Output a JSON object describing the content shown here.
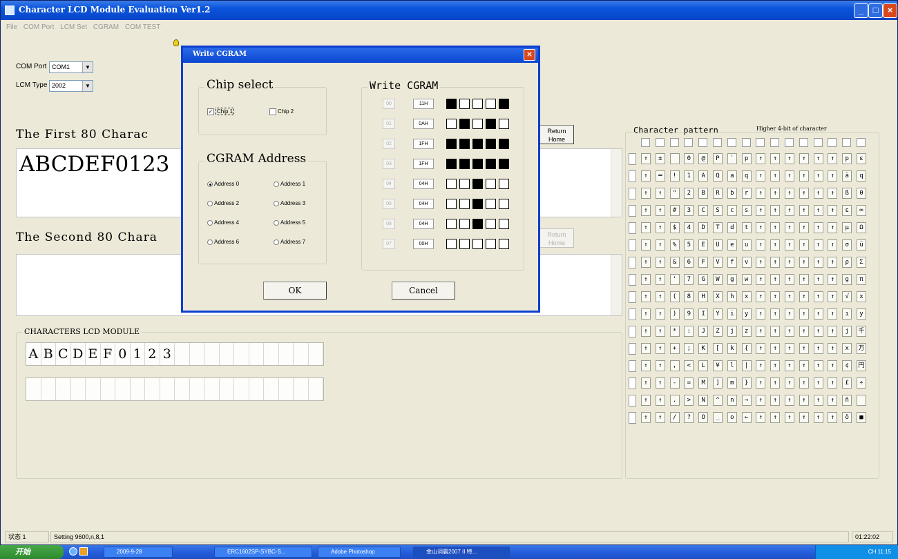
{
  "window": {
    "title": "Character LCD Module Evaluation Ver1.2"
  },
  "menu": [
    "File",
    "COM Port",
    "LCM Set",
    "CGRAM",
    "COM TEST"
  ],
  "settings": {
    "com_port_label": "COM Port",
    "com_port_value": "COM1",
    "lcm_type_label": "LCM Type",
    "lcm_type_value": "2002"
  },
  "first": {
    "heading": "The First 80 Charac",
    "text": "ABCDEF0123",
    "return_button": "Return Home"
  },
  "second": {
    "heading": "The Second 80 Chara",
    "return_button": "Return Home"
  },
  "lcd": {
    "title": "CHARACTERS LCD MODULE",
    "row1": [
      "A",
      "B",
      "C",
      "D",
      "E",
      "F",
      "0",
      "1",
      "2",
      "3",
      "",
      "",
      "",
      "",
      "",
      "",
      "",
      "",
      "",
      ""
    ],
    "row2": [
      "",
      "",
      "",
      "",
      "",
      "",
      "",
      "",
      "",
      "",
      "",
      "",
      "",
      "",
      "",
      "",
      "",
      "",
      "",
      ""
    ]
  },
  "pattern": {
    "title": "Character pattern",
    "subtitle": "Higher 4-bit of character",
    "rows": [
      [
        "↑",
        "±",
        " ",
        "0",
        "@",
        "P",
        "`",
        "p",
        "↑",
        "↑",
        "↑",
        "↑",
        "↑",
        "↑",
        "р",
        "ε"
      ],
      [
        "↑",
        "═",
        "!",
        "1",
        "A",
        "Q",
        "a",
        "q",
        "↑",
        "↑",
        "↑",
        "↑",
        "↑",
        "↑",
        "ä",
        "q"
      ],
      [
        "↑",
        "↑",
        "\"",
        "2",
        "B",
        "R",
        "b",
        "r",
        "↑",
        "↑",
        "↑",
        "↑",
        "↑",
        "↑",
        "ß",
        "θ"
      ],
      [
        "↑",
        "↑",
        "#",
        "3",
        "C",
        "S",
        "c",
        "s",
        "↑",
        "↑",
        "↑",
        "↑",
        "↑",
        "↑",
        "ε",
        "∞"
      ],
      [
        "↑",
        "↑",
        "$",
        "4",
        "D",
        "T",
        "d",
        "t",
        "↑",
        "↑",
        "↑",
        "↑",
        "↑",
        "↑",
        "μ",
        "Ω"
      ],
      [
        "↑",
        "↑",
        "%",
        "5",
        "E",
        "U",
        "e",
        "u",
        "↑",
        "↑",
        "↑",
        "↑",
        "↑",
        "↑",
        "σ",
        "ü"
      ],
      [
        "↑",
        "↑",
        "&",
        "6",
        "F",
        "V",
        "f",
        "v",
        "↑",
        "↑",
        "↑",
        "↑",
        "↑",
        "↑",
        "ρ",
        "Σ"
      ],
      [
        "↑",
        "↑",
        "'",
        "7",
        "G",
        "W",
        "g",
        "w",
        "↑",
        "↑",
        "↑",
        "↑",
        "↑",
        "↑",
        "g",
        "π"
      ],
      [
        "↑",
        "↑",
        "(",
        "8",
        "H",
        "X",
        "h",
        "x",
        "↑",
        "↑",
        "↑",
        "↑",
        "↑",
        "↑",
        "√",
        "x"
      ],
      [
        "↑",
        "↑",
        ")",
        "9",
        "I",
        "Y",
        "i",
        "y",
        "↑",
        "↑",
        "↑",
        "↑",
        "↑",
        "↑",
        "ı",
        "y"
      ],
      [
        "↑",
        "↑",
        "*",
        ":",
        "J",
        "Z",
        "j",
        "z",
        "↑",
        "↑",
        "↑",
        "↑",
        "↑",
        "↑",
        "j",
        "千"
      ],
      [
        "↑",
        "↑",
        "+",
        ";",
        "K",
        "[",
        "k",
        "{",
        "↑",
        "↑",
        "↑",
        "↑",
        "↑",
        "↑",
        "x",
        "万"
      ],
      [
        "↑",
        "↑",
        ",",
        "<",
        "L",
        "¥",
        "l",
        "|",
        "↑",
        "↑",
        "↑",
        "↑",
        "↑",
        "↑",
        "¢",
        "円"
      ],
      [
        "↑",
        "↑",
        "-",
        "=",
        "M",
        "]",
        "m",
        "}",
        "↑",
        "↑",
        "↑",
        "↑",
        "↑",
        "↑",
        "£",
        "÷"
      ],
      [
        "↑",
        "↑",
        ".",
        ">",
        "N",
        "^",
        "n",
        "→",
        "↑",
        "↑",
        "↑",
        "↑",
        "↑",
        "↑",
        "ñ",
        " "
      ],
      [
        "↑",
        "↑",
        "/",
        "?",
        "O",
        "_",
        "o",
        "←",
        "↑",
        "↑",
        "↑",
        "↑",
        "↑",
        "↑",
        "ö",
        "■"
      ]
    ]
  },
  "status": {
    "left": "状态 1",
    "setting": "Setting   9600,n,8,1",
    "time": "01:22:02"
  },
  "taskbar": {
    "start": "开始",
    "tasks": [
      "2009-9-28",
      "ERC1602SP-SYBC-S...",
      "Adobe Photoshop",
      "金山词霸2007 II 特..."
    ],
    "clock": "CH 11:15"
  },
  "dialog": {
    "title": "Write CGRAM",
    "chip_select_title": "Chip select",
    "chip1": "Chip 1",
    "chip2": "Chip 2",
    "cgram_address_title": "CGRAM Address",
    "addresses": [
      "Address 0",
      "Address 1",
      "Address 2",
      "Address 3",
      "Address 4",
      "Address 5",
      "Address 6",
      "Address 7"
    ],
    "write_title": "Write CGRAM",
    "rows": [
      {
        "addr": "00",
        "hex": "11H",
        "bits": [
          1,
          0,
          0,
          0,
          1
        ]
      },
      {
        "addr": "01",
        "hex": "0AH",
        "bits": [
          0,
          1,
          0,
          1,
          0
        ]
      },
      {
        "addr": "02",
        "hex": "1FH",
        "bits": [
          1,
          1,
          1,
          1,
          1
        ]
      },
      {
        "addr": "03",
        "hex": "1FH",
        "bits": [
          1,
          1,
          1,
          1,
          1
        ]
      },
      {
        "addr": "04",
        "hex": "04H",
        "bits": [
          0,
          0,
          1,
          0,
          0
        ]
      },
      {
        "addr": "05",
        "hex": "04H",
        "bits": [
          0,
          0,
          1,
          0,
          0
        ]
      },
      {
        "addr": "06",
        "hex": "04H",
        "bits": [
          0,
          0,
          1,
          0,
          0
        ]
      },
      {
        "addr": "07",
        "hex": "00H",
        "bits": [
          0,
          0,
          0,
          0,
          0
        ]
      }
    ],
    "ok": "OK",
    "cancel": "Cancel"
  }
}
